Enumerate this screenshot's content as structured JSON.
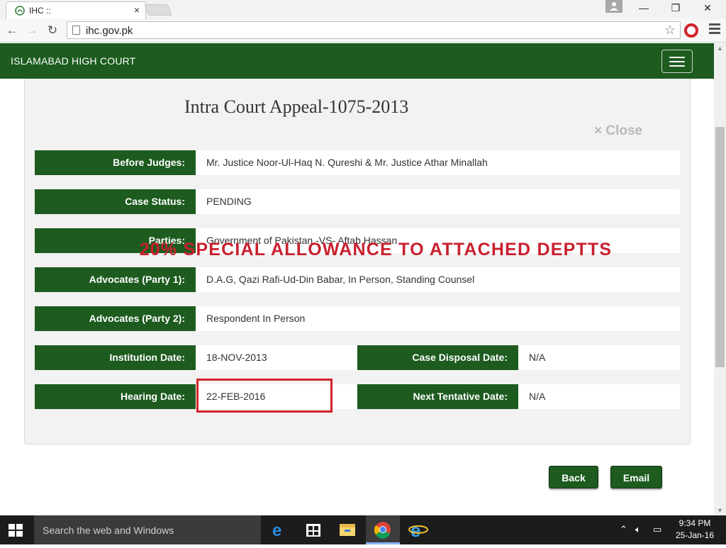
{
  "browser": {
    "tab_title": "IHC ::",
    "tab_close": "×",
    "url": "ihc.gov.pk",
    "window_controls": [
      "—",
      "❐",
      "✕"
    ]
  },
  "site": {
    "brand": "ISLAMABAD HIGH COURT"
  },
  "case": {
    "title": "Intra Court Appeal-1075-2013",
    "close_label": "× Close",
    "fields": {
      "before_judges": {
        "label": "Before Judges:",
        "value": "Mr. Justice Noor-Ul-Haq N. Qureshi & Mr. Justice Athar Minallah"
      },
      "case_status": {
        "label": "Case Status:",
        "value": "PENDING"
      },
      "parties": {
        "label": "Parties:",
        "value": "Government of Pakistan -VS- Aftab Hassan"
      },
      "advocates_1": {
        "label": "Advocates (Party 1):",
        "value": "D.A.G, Qazi Rafi-Ud-Din Babar, In Person, Standing Counsel"
      },
      "advocates_2": {
        "label": "Advocates (Party 2):",
        "value": "Respondent In Person"
      },
      "institution_date": {
        "label": "Institution Date:",
        "value": "18-NOV-2013"
      },
      "case_disposal_date": {
        "label": "Case Disposal Date:",
        "value": "N/A"
      },
      "hearing_date": {
        "label": "Hearing Date:",
        "value": "22-FEB-2016"
      },
      "next_tentative_date": {
        "label": "Next Tentative Date:",
        "value": "N/A"
      }
    },
    "overlay_text": "20% SPECIAL ALLOWANCE TO ATTACHED DEPTTS",
    "buttons": {
      "back": "Back",
      "email": "Email"
    }
  },
  "taskbar": {
    "search_placeholder": "Search the web and Windows",
    "time": "9:34 PM",
    "date": "25-Jan-16"
  },
  "colors": {
    "brand_green": "#1d5b1f",
    "highlight_red": "#d2232a"
  }
}
